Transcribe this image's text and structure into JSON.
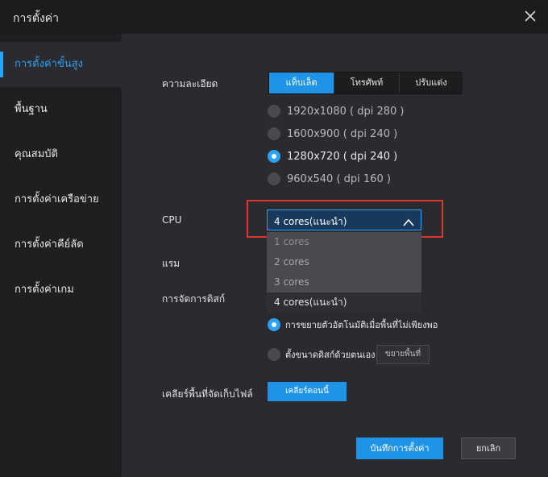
{
  "window": {
    "title": "การตั้งค่า",
    "close_icon": "close-icon"
  },
  "sidebar": {
    "items": [
      {
        "label": "การตั้งค่าขั้นสูง",
        "active": true
      },
      {
        "label": "พื้นฐาน",
        "active": false
      },
      {
        "label": "คุณสมบัติ",
        "active": false
      },
      {
        "label": "การตั้งค่าเครือข่าย",
        "active": false
      },
      {
        "label": "การตั้งค่าคีย์ลัด",
        "active": false
      },
      {
        "label": "การตั้งค่าเกม",
        "active": false
      }
    ]
  },
  "resolution": {
    "label": "ความละเอียด",
    "tabs": [
      {
        "label": "แท็บเล็ต",
        "active": true
      },
      {
        "label": "โทรศัพท์",
        "active": false
      },
      {
        "label": "ปรับแต่ง",
        "active": false
      }
    ],
    "options": [
      {
        "label": "1920x1080 ( dpi 280 )",
        "selected": false
      },
      {
        "label": "1600x900 ( dpi 240 )",
        "selected": false
      },
      {
        "label": "1280x720 ( dpi 240 )",
        "selected": true
      },
      {
        "label": "960x540 ( dpi 160 )",
        "selected": false
      }
    ]
  },
  "cpu": {
    "label": "CPU",
    "selected": "4 cores(แนะนำ)",
    "options": [
      "1 cores",
      "2 cores",
      "3 cores",
      "4 cores(แนะนำ)"
    ],
    "chevron_icon": "chevron-up-icon"
  },
  "ram": {
    "label": "แรม"
  },
  "disk": {
    "label": "การจัดการดิสก์",
    "auto_expand_label": "การขยายตัวอัตโนมัติเมื่อพื้นที่ไม่เพียงพอ",
    "manual_label": "ตั้งขนาดดิสก์ด้วยตนเอง",
    "expand_button": "ขยายพื้นที่"
  },
  "cache": {
    "label": "เคลียร์พื้นที่จัดเก็บไฟล์",
    "button": "เคลียร์ตอนนี้"
  },
  "footer": {
    "save_button": "บันทึกการตั้งค่า",
    "cancel_button": "ยกเลิก"
  },
  "colors": {
    "accent": "#1f93e6",
    "highlight_box": "#e0322f",
    "background": "#2b2b2f"
  }
}
